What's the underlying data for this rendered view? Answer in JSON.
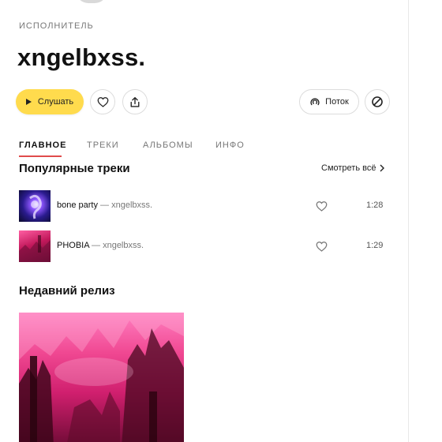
{
  "artist": {
    "label": "ИСПОЛНИТЕЛЬ",
    "name": "xngelbxss."
  },
  "actions": {
    "listen_label": "Слушать",
    "flow_label": "Поток"
  },
  "tabs": [
    {
      "label": "ГЛАВНОЕ",
      "active": true
    },
    {
      "label": "ТРЕКИ",
      "active": false
    },
    {
      "label": "АЛЬБОМЫ",
      "active": false
    },
    {
      "label": "ИНФО",
      "active": false
    }
  ],
  "popular": {
    "title": "Популярные треки",
    "see_all": "Смотреть всё",
    "tracks": [
      {
        "title": "bone party",
        "artist": " — xngelbxss.",
        "duration": "1:28"
      },
      {
        "title": "PHOBIA",
        "artist": " — xngelbxss.",
        "duration": "1:29"
      }
    ]
  },
  "recent": {
    "title": "Недавний релиз"
  },
  "colors": {
    "accent_yellow": "#ffdb4d",
    "tab_underline": "#e04b4b"
  }
}
